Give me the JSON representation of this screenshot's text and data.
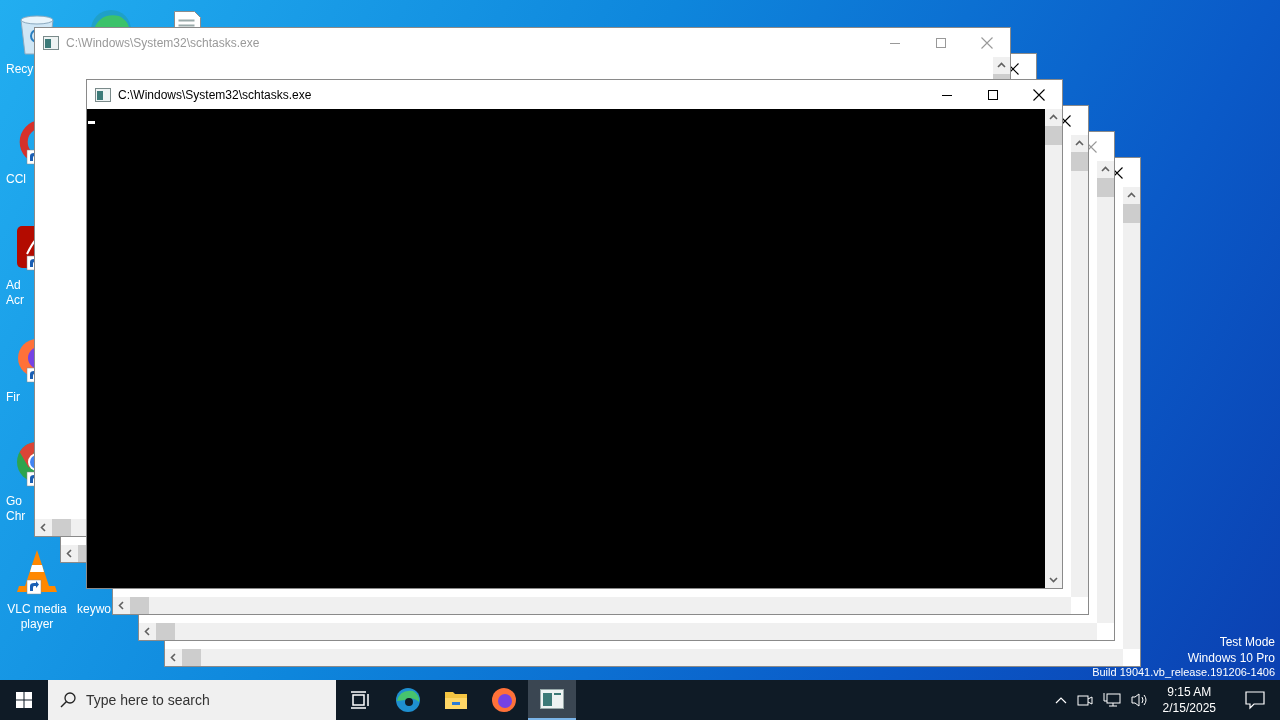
{
  "desktop": {
    "icons": [
      {
        "kind": "recycle-bin",
        "label": "Recy"
      },
      {
        "kind": "edge"
      },
      {
        "kind": "document"
      },
      {
        "kind": "ccleaner",
        "label": "CCl"
      },
      {
        "kind": "acrobat",
        "label": "Ad\nAcr"
      },
      {
        "kind": "firefox",
        "label": "Fir"
      },
      {
        "kind": "chrome",
        "label": "Go\nChr"
      },
      {
        "kind": "vlc",
        "label": "VLC media\nplayer"
      },
      {
        "kind": "hidden",
        "label": "keywo"
      }
    ],
    "notice": [
      "Test Mode",
      "Windows 10 Pro",
      "Build 19041.vb_release.191206-1406"
    ]
  },
  "windows": [
    {
      "kind": "blank",
      "active": true
    },
    {
      "kind": "blank",
      "active": false
    },
    {
      "kind": "blank",
      "active": true
    },
    {
      "kind": "blank",
      "active": true
    },
    {
      "kind": "blank",
      "active": false,
      "title": "C:\\Windows\\System32\\schtasks.exe"
    },
    {
      "kind": "console",
      "active": true,
      "title": "C:\\Windows\\System32\\schtasks.exe"
    }
  ],
  "taskbar": {
    "search": {
      "placeholder": "Type here to search"
    },
    "apps": [
      {
        "kind": "task-view",
        "selected": false
      },
      {
        "kind": "edge",
        "selected": false
      },
      {
        "kind": "explorer",
        "selected": false
      },
      {
        "kind": "firefox",
        "selected": false
      },
      {
        "kind": "console",
        "selected": true
      }
    ],
    "clock": {
      "time": "9:15 AM",
      "date": "2/15/2025"
    }
  }
}
